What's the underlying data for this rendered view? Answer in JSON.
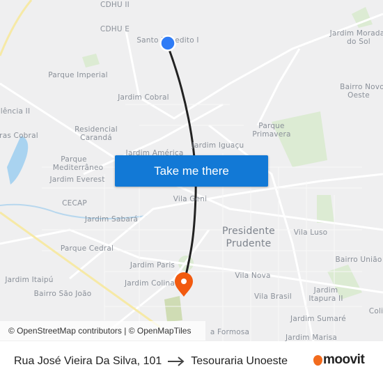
{
  "map": {
    "labels": [
      "CDHU II",
      "CDHU E",
      "Santo Expedito I",
      "Jardim Morada",
      "do Sol",
      "Parque Imperial",
      "Bairro Novo",
      "Oeste",
      "Jardim Cobral",
      "lência II",
      "Residencial",
      "Carandá",
      "ras Cobral",
      "Parque",
      "Primavera",
      "Jardim Iguaçu",
      "Jardim América",
      "Parque",
      "Mediterrâneo",
      "Jardim Everest",
      "CECAP",
      "Vila Geni",
      "Jardim Sabará",
      "Presidente",
      "Prudente",
      "Vila Luso",
      "Parque Cedral",
      "Bairro União",
      "Jardim Paris",
      "Vila Nova",
      "Jardim Itaipú",
      "Jardim Colina",
      "Jardim",
      "Itapura II",
      "Bairro São João",
      "Vila Brasil",
      "Coli",
      "Jardim Sumaré",
      "a Formosa",
      "Jardim Marisa"
    ],
    "origin_color": "#2f7cf6",
    "destination_color": "#f25a0f",
    "route_color": "#222222",
    "attribution": "© OpenStreetMap contributors | © OpenMapTiles"
  },
  "take_me_there": "Take me there",
  "footer": {
    "origin": "Rua José Vieira Da Silva, 101",
    "arrow_icon": "arrow-right-icon",
    "destination": "Tesouraria Unoeste",
    "logo": "moovit"
  }
}
